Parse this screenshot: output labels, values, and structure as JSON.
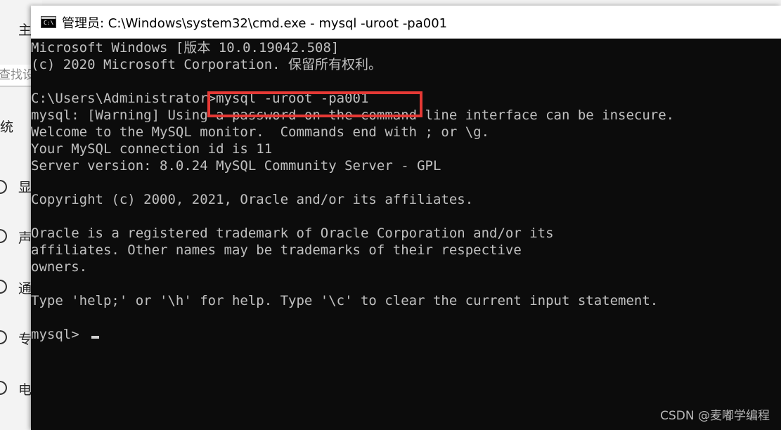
{
  "background_window": {
    "items": [
      "主",
      "统",
      "显",
      "声",
      "通",
      "专",
      "电"
    ],
    "search_text": "查找设"
  },
  "cmd": {
    "title": "管理员: C:\\Windows\\system32\\cmd.exe - mysql  -uroot -pa001",
    "icon_text": "C:\\",
    "lines": [
      "Microsoft Windows [版本 10.0.19042.508]",
      "(c) 2020 Microsoft Corporation. 保留所有权利。",
      "",
      "C:\\Users\\Administrator>mysql -uroot -pa001",
      "mysql: [Warning] Using a password on the command line interface can be insecure.",
      "Welcome to the MySQL monitor.  Commands end with ; or \\g.",
      "Your MySQL connection id is 11",
      "Server version: 8.0.24 MySQL Community Server - GPL",
      "",
      "Copyright (c) 2000, 2021, Oracle and/or its affiliates.",
      "",
      "Oracle is a registered trademark of Oracle Corporation and/or its",
      "affiliates. Other names may be trademarks of their respective",
      "owners.",
      "",
      "Type 'help;' or '\\h' for help. Type '\\c' to clear the current input statement.",
      "",
      "mysql> "
    ],
    "highlight_color": "#e53935"
  },
  "watermark": "CSDN @麦嘟学编程"
}
